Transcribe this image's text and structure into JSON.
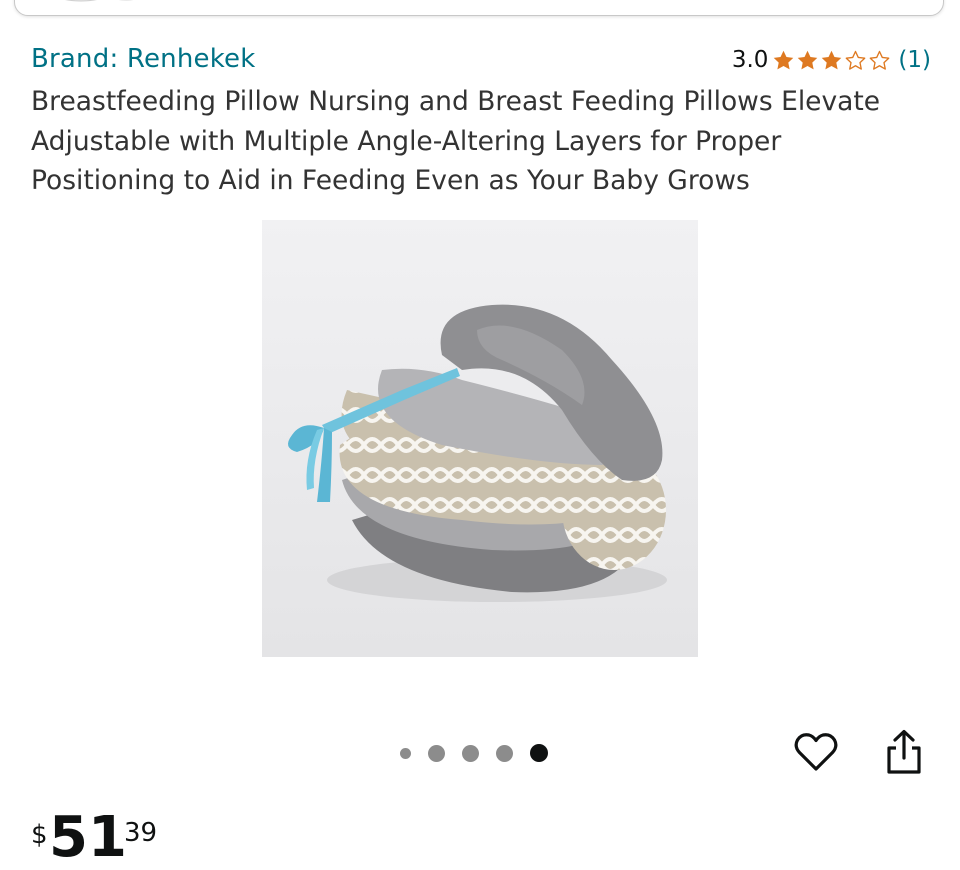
{
  "product": {
    "brand_label": "Brand: Renhekek",
    "rating_value": "3.0",
    "rating_stars": 3,
    "rating_max": 5,
    "review_count": "(1)",
    "title": "Breastfeeding Pillow Nursing and Breast Feeding Pillows Elevate Adjustable with Multiple Angle-Altering Layers for Proper Positioning to Aid in Feeding Even as Your Baby Grows",
    "image_icon": "nursing-pillow-photo"
  },
  "carousel": {
    "total": 5,
    "active_index": 4
  },
  "actions": {
    "wishlist_icon": "heart-icon",
    "share_icon": "share-icon"
  },
  "price": {
    "symbol": "$",
    "whole": "51",
    "fraction": "39"
  },
  "colors": {
    "link": "#007185",
    "star": "#de7921",
    "text": "#0f1111"
  }
}
